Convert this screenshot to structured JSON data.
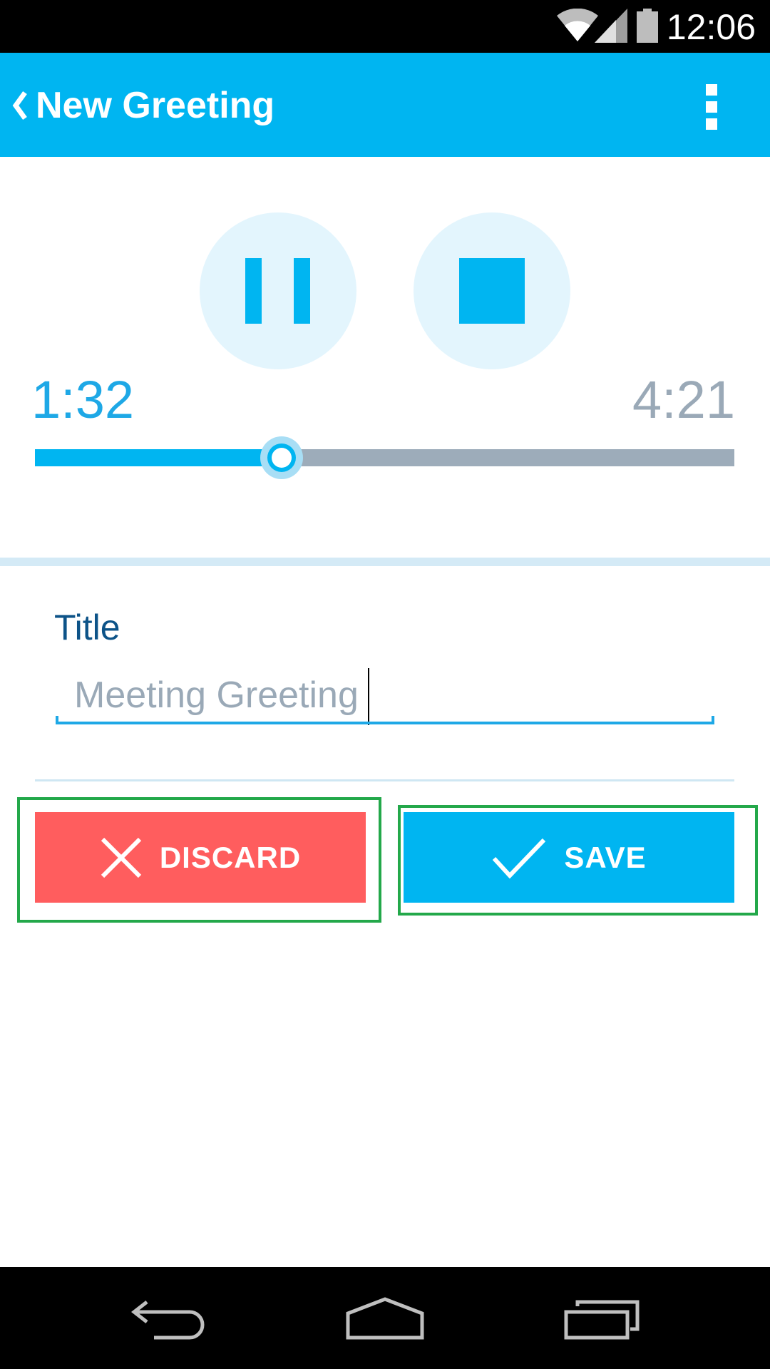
{
  "status_bar": {
    "time": "12:06",
    "icons": [
      "wifi-icon",
      "signal-icon",
      "battery-icon"
    ]
  },
  "app_bar": {
    "back_icon": "chevron-left-icon",
    "title": "New Greeting",
    "menu_icon": "overflow-menu-icon"
  },
  "player": {
    "controls": [
      "pause-icon",
      "stop-icon"
    ],
    "elapsed": "1:32",
    "total": "4:21",
    "progress_fraction": 0.353
  },
  "form": {
    "title_label": "Title",
    "title_value": "Meeting Greeting"
  },
  "actions": {
    "discard_label": "DISCARD",
    "discard_icon": "close-icon",
    "save_label": "SAVE",
    "save_icon": "checkmark-icon"
  },
  "nav_bar": {
    "buttons": [
      "back-icon",
      "home-icon",
      "recents-icon"
    ]
  },
  "colors": {
    "primary": "#00b5f1",
    "discard": "#ff5d5e",
    "title_label": "#0d5388",
    "muted": "#9aa9b7",
    "highlight_frame": "#23a84a"
  }
}
